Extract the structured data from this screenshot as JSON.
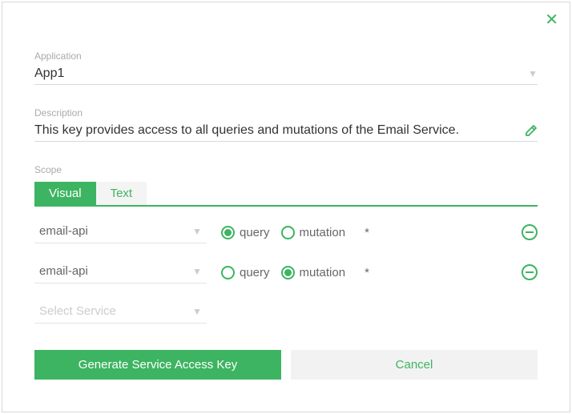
{
  "close_icon": "✕",
  "fields": {
    "application": {
      "label": "Application",
      "value": "App1"
    },
    "description": {
      "label": "Description",
      "value": "This key provides access to all queries and mutations of the Email Service."
    },
    "scope": {
      "label": "Scope"
    }
  },
  "tabs": {
    "visual": "Visual",
    "text": "Text"
  },
  "scope_rows": [
    {
      "service": "email-api",
      "query_label": "query",
      "mutation_label": "mutation",
      "selected": "query",
      "wildcard": "*"
    },
    {
      "service": "email-api",
      "query_label": "query",
      "mutation_label": "mutation",
      "selected": "mutation",
      "wildcard": "*"
    }
  ],
  "service_placeholder": "Select Service",
  "buttons": {
    "generate": "Generate Service Access Key",
    "cancel": "Cancel"
  }
}
